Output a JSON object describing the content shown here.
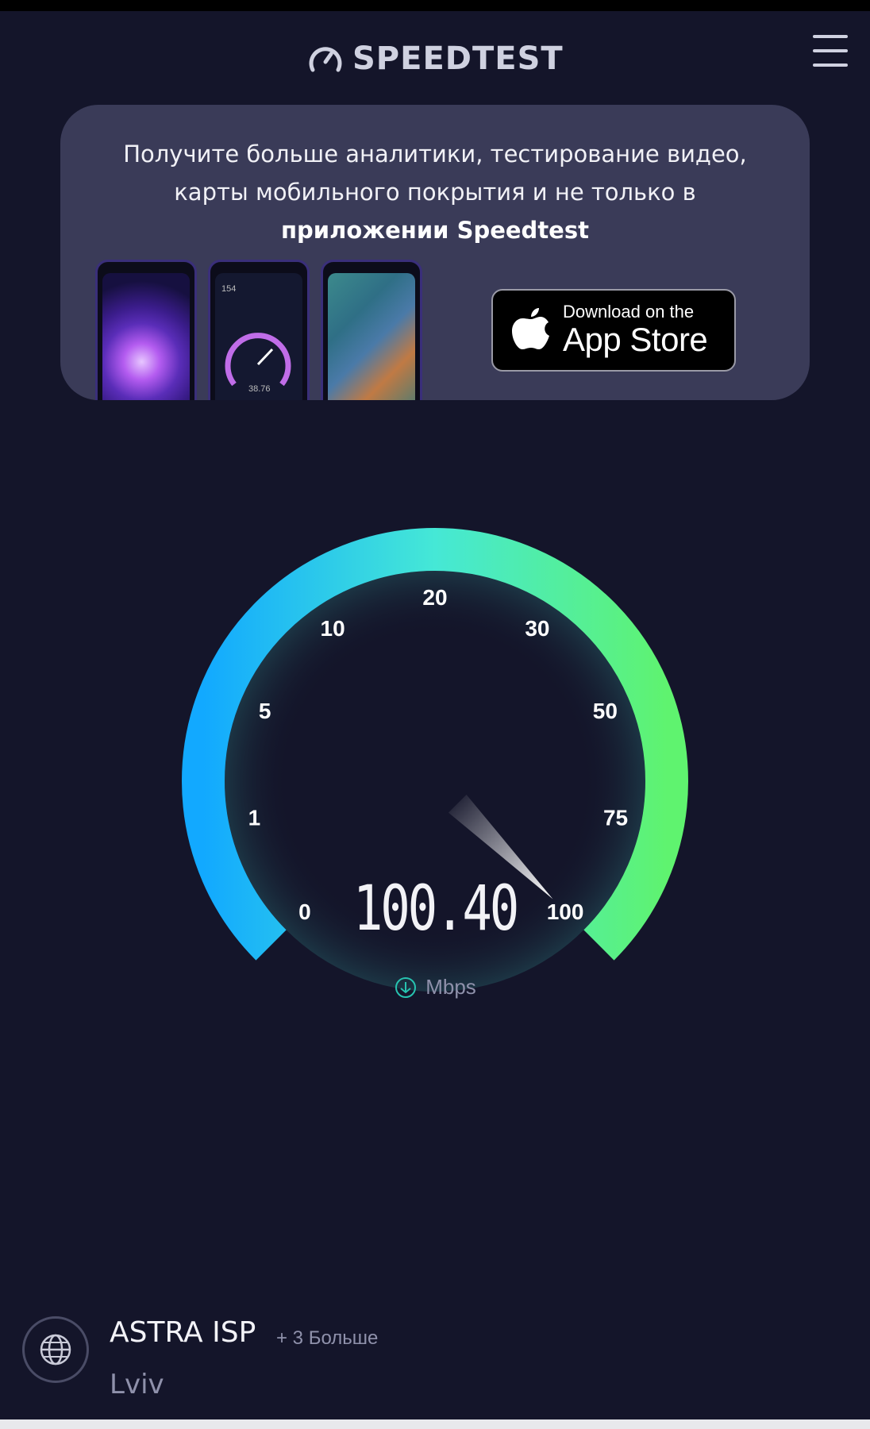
{
  "header": {
    "logo_text": "SPEEDTEST",
    "menu_icon": "hamburger-menu-icon"
  },
  "promo": {
    "line1": "Получите больше аналитики, тестирование видео,",
    "line2": "карты мобильного покрытия и не только в",
    "line3": "приложении Speedtest",
    "phone2_top_value": "154",
    "phone2_gauge_value": "38.76",
    "appstore_small": "Download on the",
    "appstore_big": "App Store",
    "appstore_icon": "apple-logo-icon"
  },
  "gauge": {
    "ticks": [
      "0",
      "1",
      "5",
      "10",
      "20",
      "30",
      "50",
      "75",
      "100"
    ],
    "value": "100.40",
    "unit": "Mbps",
    "needle_reading": 100.4,
    "colors": {
      "start": "#12a9ff",
      "middle": "#45e8d6",
      "end": "#5ff36f"
    }
  },
  "footer": {
    "isp": "ASTRA ISP",
    "more": "+ 3 Больше",
    "city": "Lviv",
    "icon": "globe-icon"
  }
}
